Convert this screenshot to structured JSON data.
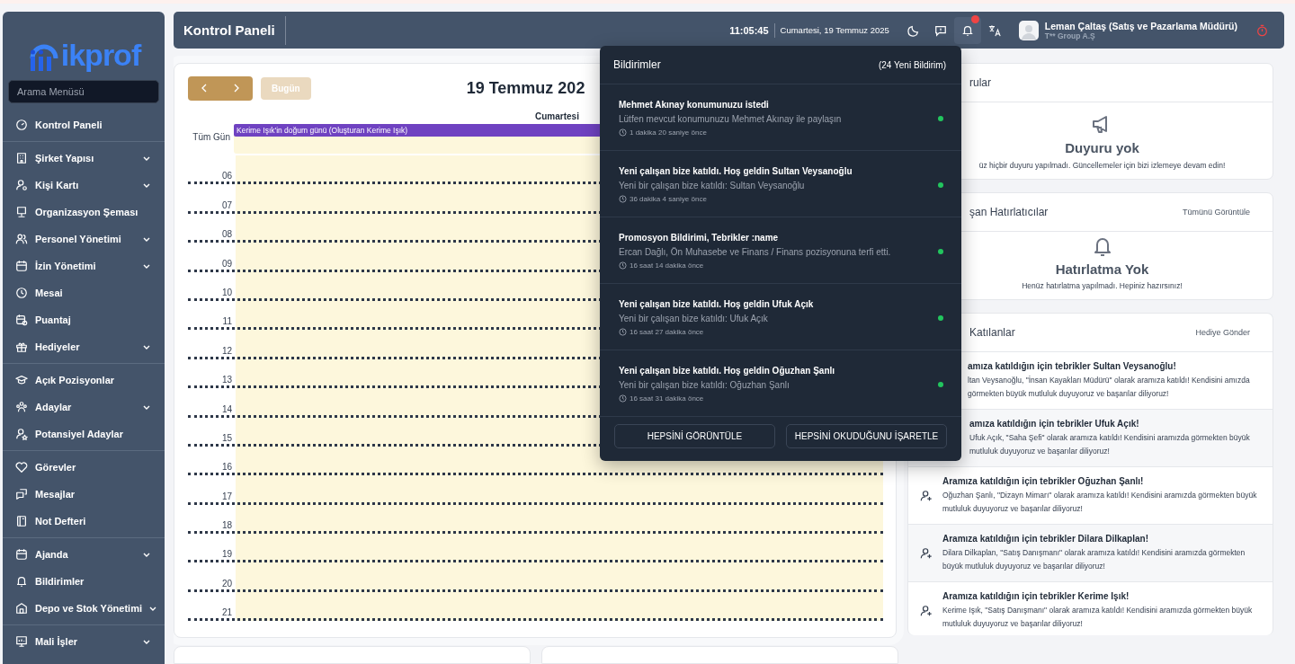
{
  "sidebar": {
    "logo": "ikprof",
    "search": {
      "placeholder": "Arama Menüsü"
    },
    "groups": [
      [
        {
          "label": "Kontrol Paneli",
          "expandable": false
        }
      ],
      [
        {
          "label": "Şirket Yapısı",
          "expandable": true
        },
        {
          "label": "Kişi Kartı",
          "expandable": true
        },
        {
          "label": "Organizasyon Şeması",
          "expandable": false
        },
        {
          "label": "Personel Yönetimi",
          "expandable": true
        },
        {
          "label": "İzin Yönetimi",
          "expandable": true
        },
        {
          "label": "Mesai",
          "expandable": false
        },
        {
          "label": "Puantaj",
          "expandable": false
        },
        {
          "label": "Hediyeler",
          "expandable": true
        }
      ],
      [
        {
          "label": "Açık Pozisyonlar",
          "expandable": false
        },
        {
          "label": "Adaylar",
          "expandable": true
        },
        {
          "label": "Potansiyel Adaylar",
          "expandable": false
        }
      ],
      [
        {
          "label": "Görevler",
          "expandable": false
        },
        {
          "label": "Mesajlar",
          "expandable": false
        },
        {
          "label": "Not Defteri",
          "expandable": false
        }
      ],
      [
        {
          "label": "Ajanda",
          "expandable": true
        },
        {
          "label": "Bildirimler",
          "expandable": false
        },
        {
          "label": "Depo ve Stok Yönetimi",
          "expandable": true
        }
      ],
      [
        {
          "label": "Mali İşler",
          "expandable": true
        }
      ]
    ]
  },
  "topbar": {
    "title": "Kontrol Paneli",
    "time": "11:05:45",
    "date": "Cumartesi, 19 Temmuz 2025",
    "has_unread": true,
    "user": {
      "name": "Leman Çaltaş (Satış ve Pazarlama Müdürü)",
      "company": "T** Group A.Ş"
    }
  },
  "calendar": {
    "today_button": "Bugün",
    "title": "19 Temmuz 202",
    "day": "Cumartesi",
    "all_day_label": "Tüm Gün",
    "events": [
      {
        "title": "Kerime Işık'in doğum günü (Oluşturan Kerime Işık)",
        "color": "#6f42c1"
      }
    ],
    "hours": [
      "06",
      "07",
      "08",
      "09",
      "10",
      "11",
      "12",
      "13",
      "14",
      "15",
      "16",
      "17",
      "18",
      "19",
      "20",
      "21"
    ]
  },
  "announcements": {
    "title": "rular",
    "empty_title": "Duyuru yok",
    "empty_text": "üz hiçbir duyuru yapılmadı. Güncellemeler için bizi izlemeye devam edin!"
  },
  "reminders": {
    "title": "şan Hatırlatıcılar",
    "link": "Tümünü Görüntüle",
    "empty_title": "Hatırlatma Yok",
    "empty_text": "Henüz hatırlatma yapılmadı. Hepiniz hazırsınız!"
  },
  "new_joiners": {
    "title": "Katılanlar",
    "link": "Hediye Gönder",
    "items": [
      {
        "title": "amıza katıldığın için tebrikler Sultan Veysanoğlu!",
        "body": "ltan Veysanoğlu, \"İnsan Kayakları Müdürü\" olarak aramıza katıldı! Kendisini amızda görmekten büyük mutluluk duyuyoruz ve başarılar diliyoruz!"
      },
      {
        "title": "amıza katıldığın için tebrikler Ufuk Açık!",
        "body": "Ufuk Açık, \"Saha Şefi\" olarak aramıza katıldı! Kendisini aramızda görmekten büyük mutluluk duyuyoruz ve başarılar diliyoruz!"
      },
      {
        "title": "Aramıza katıldığın için tebrikler Oğuzhan Şanlı!",
        "body": "Oğuzhan Şanlı, \"Dizayn Mimarı\" olarak aramıza katıldı! Kendisini aramızda görmekten büyük mutluluk duyuyoruz ve başarılar diliyoruz!"
      },
      {
        "title": "Aramıza katıldığın için tebrikler Dilara Dilkaplan!",
        "body": "Dilara Dilkaplan, \"Satış Danışmanı\" olarak aramıza katıldı! Kendisini aramızda görmekten büyük mutluluk duyuyoruz ve başarılar diliyoruz!"
      },
      {
        "title": "Aramıza katıldığın için tebrikler Kerime Işık!",
        "body": "Kerime Işık, \"Satış Danışmanı\" olarak aramıza katıldı! Kendisini aramızda görmekten büyük mutluluk duyuyoruz ve başarılar diliyoruz!"
      }
    ]
  },
  "notifications": {
    "title": "Bildirimler",
    "count": "(24 Yeni Bildirim)",
    "items": [
      {
        "title": "Mehmet Akınay konumunuzu istedi",
        "body": "Lütfen mevcut konumunuzu Mehmet Akınay ile paylaşın",
        "time": "1 dakika 20 saniye önce",
        "unread": true
      },
      {
        "title": "Yeni çalışan bize katıldı. Hoş geldin Sultan Veysanoğlu",
        "body": "Yeni bir çalışan bize katıldı: Sultan Veysanoğlu",
        "time": "36 dakika 4 saniye önce",
        "unread": true
      },
      {
        "title": "Promosyon Bildirimi, Tebrikler :name",
        "body": "Ercan Dağlı, Ön Muhasebe ve Finans / Finans pozisyonuna terfi etti.",
        "time": "16 saat 14 dakika önce",
        "unread": true
      },
      {
        "title": "Yeni çalışan bize katıldı. Hoş geldin Ufuk Açık",
        "body": "Yeni bir çalışan bize katıldı: Ufuk Açık",
        "time": "16 saat 27 dakika önce",
        "unread": true
      },
      {
        "title": "Yeni çalışan bize katıldı. Hoş geldin Oğuzhan Şanlı",
        "body": "Yeni bir çalışan bize katıldı: Oğuzhan Şanlı",
        "time": "16 saat 31 dakika önce",
        "unread": true
      }
    ],
    "buttons": [
      "HEPSİNİ GÖRÜNTÜLE",
      "HEPSİNİ OKUDUĞUNU İŞARETLE"
    ]
  }
}
